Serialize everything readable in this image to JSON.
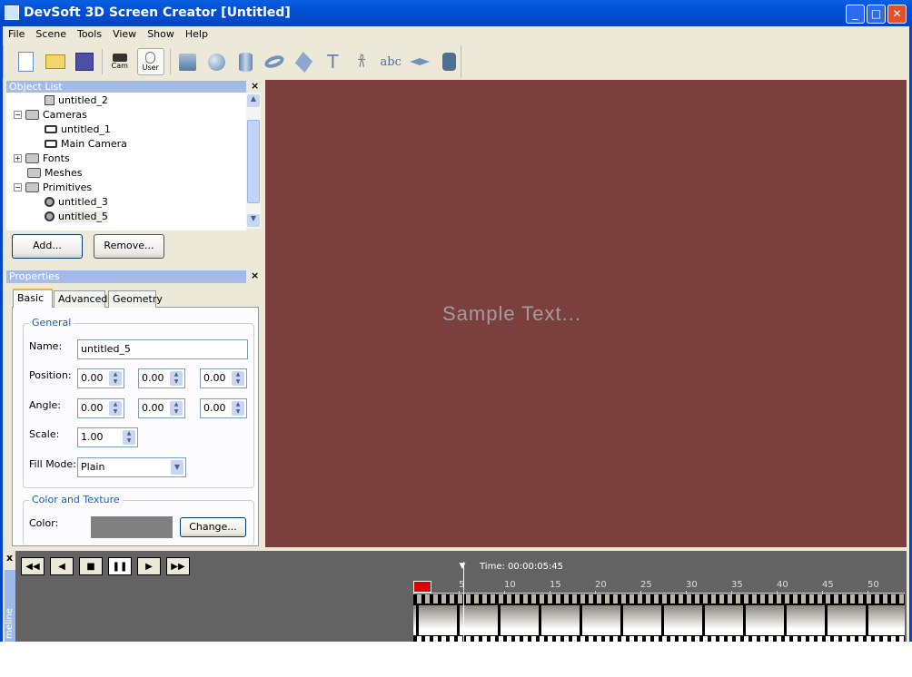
{
  "window": {
    "title": "DevSoft 3D Screen Creator [Untitled]"
  },
  "menu": [
    "File",
    "Scene",
    "Tools",
    "View",
    "Show",
    "Help"
  ],
  "toolbar": {
    "cam_label": "Cam",
    "user_label": "User",
    "icons": [
      "new-file-icon",
      "open-folder-icon",
      "save-icon",
      "camera-icon",
      "user-mouse-icon",
      "cube-icon",
      "sphere-icon",
      "cylinder-icon",
      "torus-icon",
      "plane-icon",
      "skeleton-icon",
      "walking-figure-icon",
      "text-abc-icon",
      "flat-shape-icon",
      "backpack-icon"
    ]
  },
  "object_list": {
    "title": "Object List",
    "items": [
      {
        "label": "untitled_2",
        "level": 2,
        "icon": "square-icon"
      },
      {
        "label": "Cameras",
        "level": 1,
        "icon": "folder-icon",
        "expander": "-"
      },
      {
        "label": "untitled_1",
        "level": 2,
        "icon": "camera-icon"
      },
      {
        "label": "Main Camera",
        "level": 2,
        "icon": "camera-icon"
      },
      {
        "label": "Fonts",
        "level": 1,
        "icon": "folder-icon",
        "expander": "+"
      },
      {
        "label": "Meshes",
        "level": 1,
        "icon": "folder-icon"
      },
      {
        "label": "Primitives",
        "level": 1,
        "icon": "folder-icon",
        "expander": "-"
      },
      {
        "label": "untitled_3",
        "level": 2,
        "icon": "sphere-icon"
      },
      {
        "label": "untitled_5",
        "level": 2,
        "icon": "sphere-icon",
        "selected": true
      }
    ],
    "add_label": "Add...",
    "remove_label": "Remove..."
  },
  "properties": {
    "title": "Properties",
    "tabs": [
      "Basic",
      "Advanced",
      "Geometry"
    ],
    "active_tab": "Basic",
    "general_legend": "General",
    "name_label": "Name:",
    "name_value": "untitled_5",
    "position_label": "Position:",
    "position": [
      "0.00",
      "0.00",
      "0.00"
    ],
    "angle_label": "Angle:",
    "angle": [
      "0.00",
      "0.00",
      "0.00"
    ],
    "scale_label": "Scale:",
    "scale": "1.00",
    "fill_mode_label": "Fill Mode:",
    "fill_mode": "Plain",
    "color_legend": "Color and Texture",
    "color_label": "Color:",
    "color_value": "#808080",
    "change_label": "Change..."
  },
  "viewport": {
    "background": "#7b3f3e",
    "sample_text": "Sample Text..."
  },
  "timeline": {
    "side_label": "meline",
    "close": "x",
    "time_text": "Time: 00:00:05:45",
    "current_seconds": 5.45,
    "ticks": [
      "0",
      "5",
      "10",
      "15",
      "20",
      "25",
      "30",
      "35",
      "40",
      "45",
      "50"
    ]
  }
}
